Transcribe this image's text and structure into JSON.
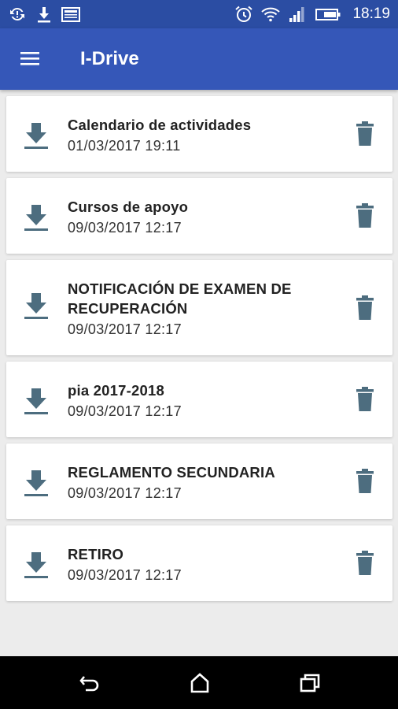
{
  "status_bar": {
    "time": "18:19",
    "left_icons": [
      "sync-icon",
      "download-icon",
      "image-icon"
    ],
    "right_icons": [
      "alarm-icon",
      "wifi-icon",
      "signal-icon",
      "battery-icon"
    ]
  },
  "app_bar": {
    "title": "I-Drive",
    "color": "#3557b8"
  },
  "files": [
    {
      "name": "Calendario de actividades",
      "date": "01/03/2017 19:11"
    },
    {
      "name": "Cursos de apoyo",
      "date": "09/03/2017 12:17"
    },
    {
      "name": "NOTIFICACIÓN DE EXAMEN DE RECUPERACIÓN",
      "date": "09/03/2017 12:17"
    },
    {
      "name": "pia 2017-2018",
      "date": "09/03/2017 12:17"
    },
    {
      "name": "REGLAMENTO SECUNDARIA",
      "date": "09/03/2017 12:17"
    },
    {
      "name": "RETIRO",
      "date": "09/03/2017 12:17"
    }
  ],
  "icon_color": "#4d6d7f",
  "nav_bar": {
    "buttons": [
      "back-icon",
      "home-icon",
      "recents-icon"
    ]
  }
}
